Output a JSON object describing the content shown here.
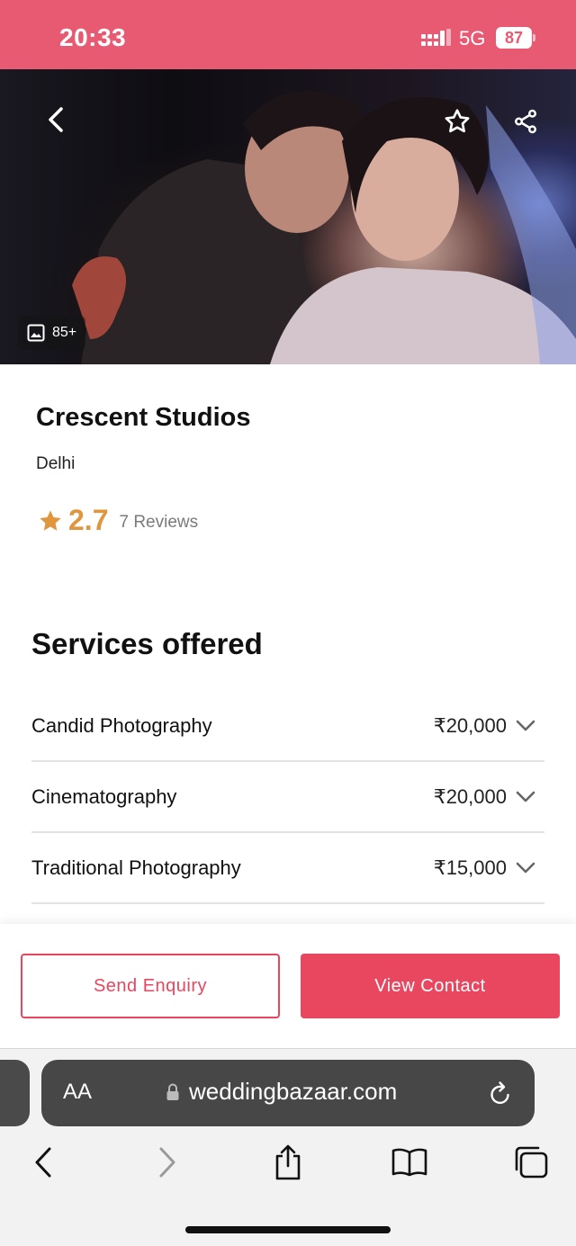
{
  "status_bar": {
    "time": "20:33",
    "network": "5G",
    "battery": "87"
  },
  "hero": {
    "photo_count": "85+"
  },
  "vendor": {
    "name": "Crescent Studios",
    "city": "Delhi",
    "rating": "2.7",
    "reviews": "7 Reviews"
  },
  "services": {
    "title": "Services offered",
    "items": [
      {
        "name": "Candid Photography",
        "price": "₹20,000"
      },
      {
        "name": "Cinematography",
        "price": "₹20,000"
      },
      {
        "name": "Traditional Photography",
        "price": "₹15,000"
      }
    ]
  },
  "actions": {
    "enquiry_label": "Send Enquiry",
    "contact_label": "View Contact"
  },
  "browser": {
    "aa_label": "AA",
    "url": "weddingbazaar.com"
  },
  "colors": {
    "brand": "#e9475f",
    "status_bar": "#e85a72",
    "rating": "#e0963e"
  },
  "icons": [
    "back-icon",
    "star-outline-icon",
    "share-icon",
    "image-icon",
    "star-filled-icon",
    "chevron-down-icon",
    "lock-icon",
    "reload-icon",
    "chevron-left-icon",
    "chevron-right-icon",
    "share-sheet-icon",
    "bookmarks-icon",
    "tabs-icon"
  ]
}
